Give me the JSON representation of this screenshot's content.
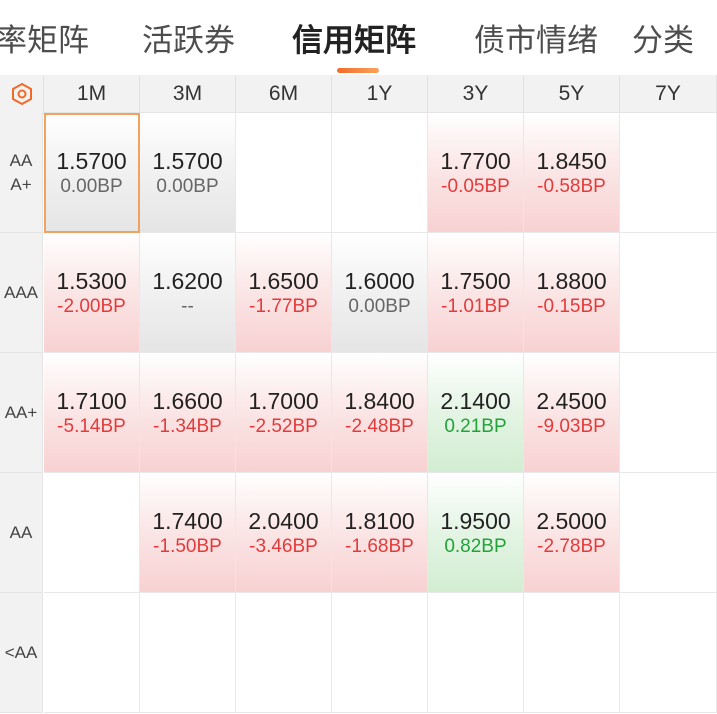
{
  "tabs": [
    {
      "label": "率矩阵",
      "active": false
    },
    {
      "label": "活跃券",
      "active": false
    },
    {
      "label": "信用矩阵",
      "active": true
    },
    {
      "label": "债市情绪",
      "active": false
    },
    {
      "label": "分类",
      "active": false
    }
  ],
  "accent_color": "#f26a2a",
  "corner_icon": "hexagon-settings-icon",
  "columns": [
    "1M",
    "3M",
    "6M",
    "1Y",
    "3Y",
    "5Y",
    "7Y"
  ],
  "rows": [
    {
      "label": "AAA+",
      "cells": [
        {
          "value": "1.5700",
          "change": "0.00BP",
          "trend": "flat",
          "selected": true
        },
        {
          "value": "1.5700",
          "change": "0.00BP",
          "trend": "flat"
        },
        {
          "value": "",
          "change": "",
          "trend": "empty"
        },
        {
          "value": "",
          "change": "",
          "trend": "empty"
        },
        {
          "value": "1.7700",
          "change": "-0.05BP",
          "trend": "neg"
        },
        {
          "value": "1.8450",
          "change": "-0.58BP",
          "trend": "neg"
        },
        {
          "value": "",
          "change": "",
          "trend": "empty"
        }
      ]
    },
    {
      "label": "AAA",
      "cells": [
        {
          "value": "1.5300",
          "change": "-2.00BP",
          "trend": "neg"
        },
        {
          "value": "1.6200",
          "change": "--",
          "trend": "flat"
        },
        {
          "value": "1.6500",
          "change": "-1.77BP",
          "trend": "neg"
        },
        {
          "value": "1.6000",
          "change": "0.00BP",
          "trend": "flat"
        },
        {
          "value": "1.7500",
          "change": "-1.01BP",
          "trend": "neg"
        },
        {
          "value": "1.8800",
          "change": "-0.15BP",
          "trend": "neg"
        },
        {
          "value": "",
          "change": "",
          "trend": "empty"
        }
      ]
    },
    {
      "label": "AA+",
      "cells": [
        {
          "value": "1.7100",
          "change": "-5.14BP",
          "trend": "neg"
        },
        {
          "value": "1.6600",
          "change": "-1.34BP",
          "trend": "neg"
        },
        {
          "value": "1.7000",
          "change": "-2.52BP",
          "trend": "neg"
        },
        {
          "value": "1.8400",
          "change": "-2.48BP",
          "trend": "neg"
        },
        {
          "value": "2.1400",
          "change": "0.21BP",
          "trend": "pos"
        },
        {
          "value": "2.4500",
          "change": "-9.03BP",
          "trend": "neg"
        },
        {
          "value": "",
          "change": "",
          "trend": "empty"
        }
      ]
    },
    {
      "label": "AA",
      "cells": [
        {
          "value": "",
          "change": "",
          "trend": "empty"
        },
        {
          "value": "1.7400",
          "change": "-1.50BP",
          "trend": "neg"
        },
        {
          "value": "2.0400",
          "change": "-3.46BP",
          "trend": "neg"
        },
        {
          "value": "1.8100",
          "change": "-1.68BP",
          "trend": "neg"
        },
        {
          "value": "1.9500",
          "change": "0.82BP",
          "trend": "pos"
        },
        {
          "value": "2.5000",
          "change": "-2.78BP",
          "trend": "neg"
        },
        {
          "value": "",
          "change": "",
          "trend": "empty"
        }
      ]
    },
    {
      "label": "<AA",
      "cells": [
        {
          "value": "",
          "change": "",
          "trend": "empty"
        },
        {
          "value": "",
          "change": "",
          "trend": "empty"
        },
        {
          "value": "",
          "change": "",
          "trend": "empty"
        },
        {
          "value": "",
          "change": "",
          "trend": "empty"
        },
        {
          "value": "",
          "change": "",
          "trend": "empty"
        },
        {
          "value": "",
          "change": "",
          "trend": "empty"
        },
        {
          "value": "",
          "change": "",
          "trend": "empty"
        }
      ]
    }
  ]
}
